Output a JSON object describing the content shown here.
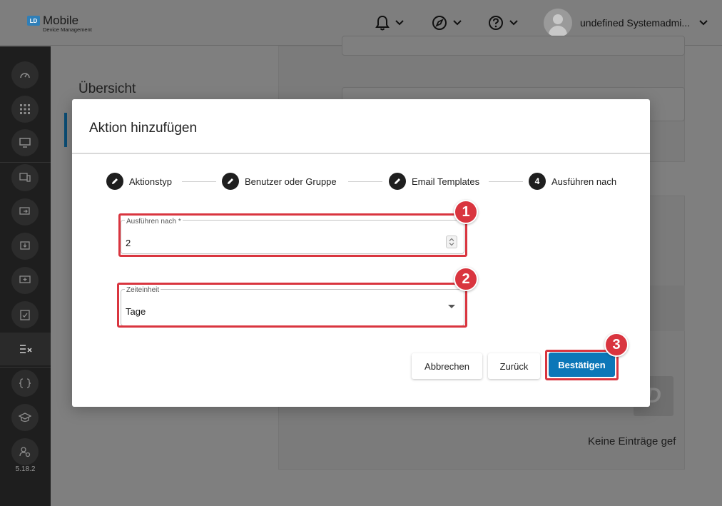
{
  "app": {
    "logo_badge": "LD",
    "logo_title": "Mobile",
    "logo_subtitle": "Device Management",
    "version": "5.18.2"
  },
  "topbar": {
    "icons": [
      "bell-icon",
      "compass-icon",
      "help-icon"
    ],
    "user_name": "undefined Systemadmi..."
  },
  "background": {
    "overview_title": "Übersicht",
    "empty_text": "Keine Einträge gef"
  },
  "modal": {
    "title": "Aktion hinzufügen",
    "steps": [
      {
        "label": "Aktionstyp",
        "state": "done",
        "icon": "pencil-icon"
      },
      {
        "label": "Benutzer oder Gruppe",
        "state": "done",
        "icon": "pencil-icon"
      },
      {
        "label": "Email Templates",
        "state": "done",
        "icon": "pencil-icon"
      },
      {
        "label": "Ausführen nach",
        "state": "active",
        "number": "4"
      }
    ],
    "field_execute": {
      "label": "Ausführen nach *",
      "value": "2"
    },
    "field_unit": {
      "label": "Zeiteinheit",
      "value": "Tage"
    },
    "buttons": {
      "cancel": "Abbrechen",
      "back": "Zurück",
      "confirm": "Bestätigen"
    },
    "callouts": [
      "1",
      "2",
      "3"
    ]
  },
  "colors": {
    "primary": "#0c77b8",
    "callout": "#d9353f",
    "sidebar": "#1e1e1e"
  }
}
